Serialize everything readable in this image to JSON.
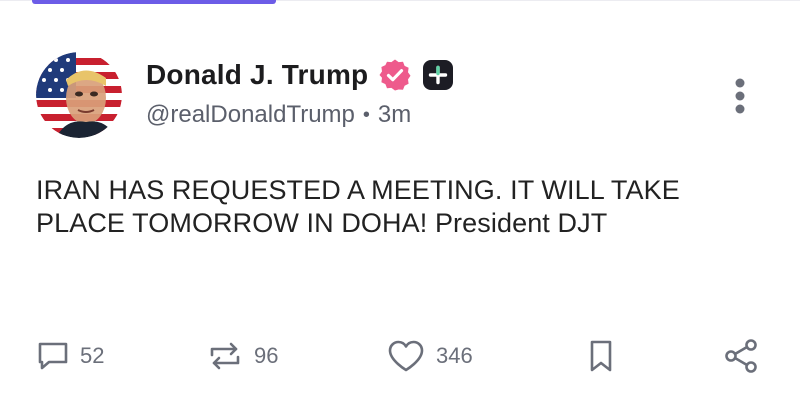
{
  "profile": {
    "display_name": "Donald J. Trump",
    "handle": "@realDonaldTrump",
    "separator": "•",
    "time_ago": "3m",
    "verified_color": "#ee5a8c",
    "avatar_icon": "flag-portrait-avatar"
  },
  "post": {
    "text": "IRAN HAS REQUESTED A MEETING. IT WILL TAKE PLACE TOMORROW IN DOHA! President DJT"
  },
  "actions": {
    "replies": "52",
    "reposts": "96",
    "likes": "346"
  },
  "colors": {
    "accent": "#6c5ce7",
    "icon_gray": "#6b6f7a",
    "text": "#1c1c1e"
  }
}
